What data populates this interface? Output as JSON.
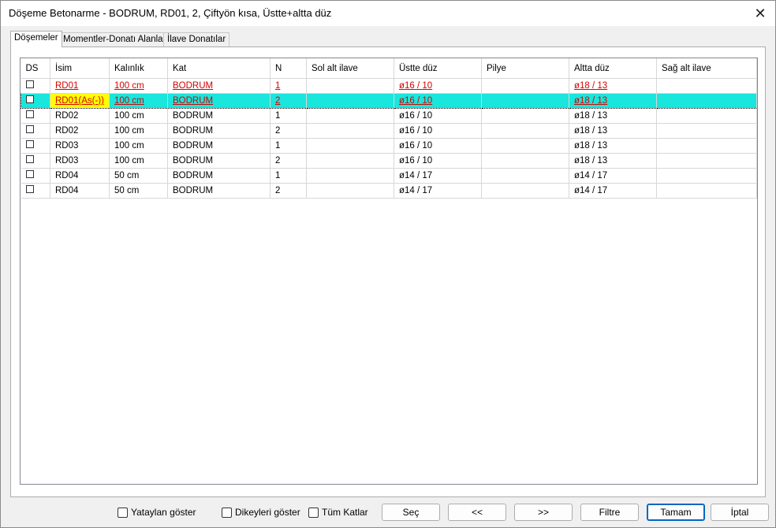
{
  "window": {
    "title": "Döşeme Betonarme - BODRUM, RD01, 2, Çiftyön kısa, Üstte+altta düz",
    "close_icon": "close-icon"
  },
  "tabs": [
    {
      "label": "Döşemeler"
    },
    {
      "label": "Momentler-Donatı Alanları"
    },
    {
      "label": "İlave Donatılar"
    }
  ],
  "table": {
    "columns": [
      "DS",
      "İsim",
      "Kalınlık",
      "Kat",
      "N",
      "Sol alt ilave",
      "Üstte düz",
      "Pilye",
      "Altta düz",
      "Sağ alt ilave"
    ],
    "rows": [
      {
        "ds": false,
        "isim": "RD01",
        "kalinlik": "100 cm",
        "kat": "BODRUM",
        "n": "1",
        "sol": "",
        "ustte": "ø16 / 10",
        "pilye": "",
        "altta": "ø18 / 13",
        "sag": "",
        "style": "red"
      },
      {
        "ds": false,
        "isim": "RD01(As(-))",
        "kalinlik": "100 cm",
        "kat": "BODRUM",
        "n": "2",
        "sol": "",
        "ustte": "ø16 / 10",
        "pilye": "",
        "altta": "ø18 / 13",
        "sag": "",
        "style": "selected"
      },
      {
        "ds": false,
        "isim": "RD02",
        "kalinlik": "100 cm",
        "kat": "BODRUM",
        "n": "1",
        "sol": "",
        "ustte": "ø16 / 10",
        "pilye": "",
        "altta": "ø18 / 13",
        "sag": "",
        "style": "normal"
      },
      {
        "ds": false,
        "isim": "RD02",
        "kalinlik": "100 cm",
        "kat": "BODRUM",
        "n": "2",
        "sol": "",
        "ustte": "ø16 / 10",
        "pilye": "",
        "altta": "ø18 / 13",
        "sag": "",
        "style": "normal"
      },
      {
        "ds": false,
        "isim": "RD03",
        "kalinlik": "100 cm",
        "kat": "BODRUM",
        "n": "1",
        "sol": "",
        "ustte": "ø16 / 10",
        "pilye": "",
        "altta": "ø18 / 13",
        "sag": "",
        "style": "normal"
      },
      {
        "ds": false,
        "isim": "RD03",
        "kalinlik": "100 cm",
        "kat": "BODRUM",
        "n": "2",
        "sol": "",
        "ustte": "ø16 / 10",
        "pilye": "",
        "altta": "ø18 / 13",
        "sag": "",
        "style": "normal"
      },
      {
        "ds": false,
        "isim": "RD04",
        "kalinlik": "50 cm",
        "kat": "BODRUM",
        "n": "1",
        "sol": "",
        "ustte": "ø14 / 17",
        "pilye": "",
        "altta": "ø14 / 17",
        "sag": "",
        "style": "normal"
      },
      {
        "ds": false,
        "isim": "RD04",
        "kalinlik": "50 cm",
        "kat": "BODRUM",
        "n": "2",
        "sol": "",
        "ustte": "ø14 / 17",
        "pilye": "",
        "altta": "ø14 / 17",
        "sag": "",
        "style": "normal"
      }
    ]
  },
  "footer": {
    "checkboxes": [
      {
        "label": "Yataylan göster",
        "checked": false
      },
      {
        "label": "Dikeyleri göster",
        "checked": false
      },
      {
        "label": "Tüm Katlar",
        "checked": false
      }
    ],
    "buttons": [
      {
        "label": "Seç"
      },
      {
        "label": "<<"
      },
      {
        "label": ">>"
      },
      {
        "label": "Filtre"
      },
      {
        "label": "Tamam"
      },
      {
        "label": "İptal"
      }
    ]
  },
  "colors": {
    "selected_row": "#19e6dc",
    "highlight_cell": "#ffff00",
    "red_text": "#d80000",
    "default_button_border": "#0067c0"
  }
}
